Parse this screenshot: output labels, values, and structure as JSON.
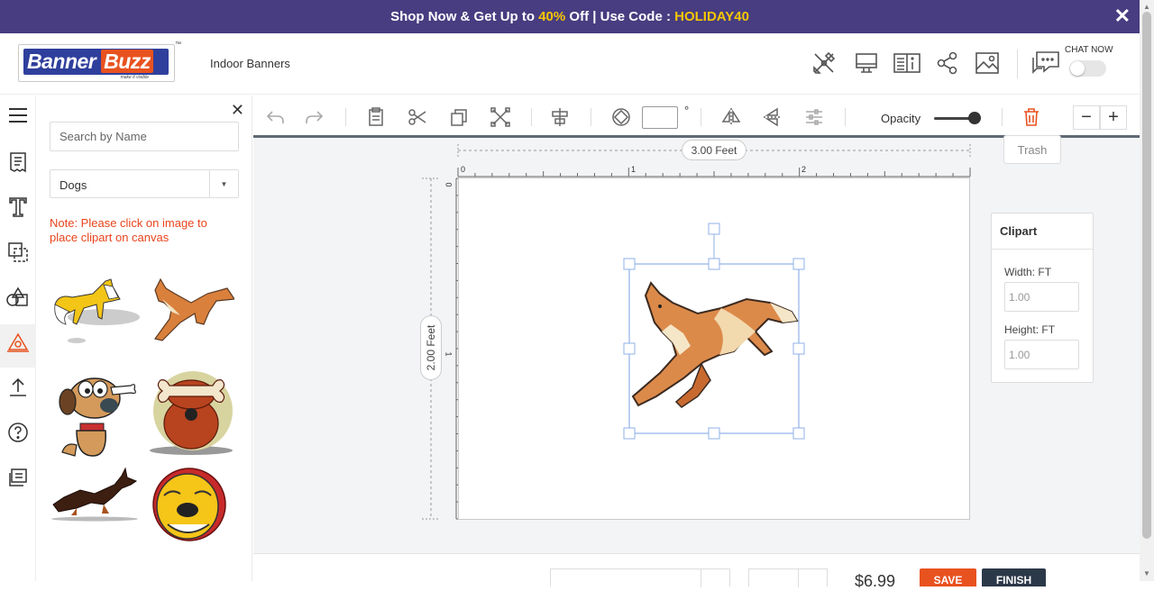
{
  "promo": {
    "prefix": "Shop Now & Get Up to ",
    "highlight": "40%",
    "middle": " Off | Use Code : ",
    "code": "HOLIDAY40",
    "close": "✕"
  },
  "header": {
    "logo_word1": "Banner",
    "logo_word2": "Buzz",
    "logo_tagline": "make it visible",
    "logo_tm": "™",
    "product_title": "Indoor Banners",
    "chat_label": "CHAT NOW"
  },
  "left_panel": {
    "close": "✕",
    "search_placeholder": "Search by Name",
    "category": "Dogs",
    "note": "Note: Please click on image to place clipart on canvas",
    "cliparts": [
      "fox",
      "running fox",
      "cartoon dog with bone",
      "dog with bone",
      "doberman",
      "bulldog"
    ]
  },
  "toolbar": {
    "degree_symbol": "°",
    "opacity_label": "Opacity",
    "opacity_value": 1.0,
    "zoom_minus": "−",
    "zoom_plus": "+",
    "trash_tooltip": "Trash"
  },
  "canvas": {
    "width_label": "3.00 Feet",
    "height_label": "2.00 Feet",
    "ruler_x": [
      "0",
      "1",
      "2"
    ],
    "ruler_y": [
      "0",
      "1"
    ]
  },
  "props": {
    "title": "Clipart",
    "width_label": "Width:",
    "width_unit": "FT",
    "width_value": "1.00",
    "height_label": "Height:",
    "height_unit": "FT",
    "height_value": "1.00"
  },
  "bottom": {
    "price": "$6.99",
    "save": "SAVE",
    "finish": "FINISH"
  },
  "colors": {
    "promo_bg": "#473d80",
    "promo_highlight": "#f7c600",
    "note": "#e8441c",
    "accent_orange": "#e8521f",
    "selection": "#8fb0e8",
    "finish_bg": "#2b3848"
  }
}
